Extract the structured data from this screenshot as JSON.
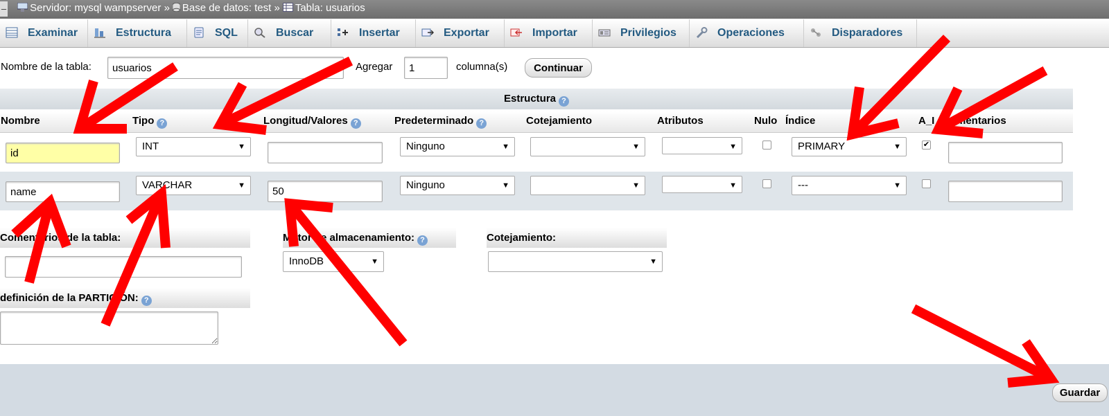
{
  "breadcrumb": {
    "server": "Servidor: mysql wampserver",
    "sep1": "»",
    "database": "Base de datos: test",
    "sep2": "»",
    "table": "Tabla: usuarios"
  },
  "tabs": [
    {
      "label": "Examinar",
      "icon": "browse-icon"
    },
    {
      "label": "Estructura",
      "icon": "structure-icon"
    },
    {
      "label": "SQL",
      "icon": "sql-icon"
    },
    {
      "label": "Buscar",
      "icon": "search-icon"
    },
    {
      "label": "Insertar",
      "icon": "insert-icon"
    },
    {
      "label": "Exportar",
      "icon": "export-icon"
    },
    {
      "label": "Importar",
      "icon": "import-icon"
    },
    {
      "label": "Privilegios",
      "icon": "privileges-icon"
    },
    {
      "label": "Operaciones",
      "icon": "wrench-icon"
    },
    {
      "label": "Disparadores",
      "icon": "triggers-icon"
    }
  ],
  "table_name": {
    "label": "Nombre de la tabla:",
    "value": "usuarios",
    "add_label": "Agregar",
    "add_value": "1",
    "columns_label": "columna(s)",
    "continue_label": "Continuar"
  },
  "structure": {
    "title": "Estructura",
    "headers": {
      "name": "Nombre",
      "type": "Tipo",
      "length": "Longitud/Valores",
      "default": "Predeterminado",
      "collation": "Cotejamiento",
      "attributes": "Atributos",
      "null": "Nulo",
      "index": "Índice",
      "ai": "A_I",
      "comments": "Comentarios"
    },
    "rows": [
      {
        "name": "id",
        "type": "INT",
        "length": "",
        "default": "Ninguno",
        "collation": "",
        "attributes": "",
        "null": false,
        "index": "PRIMARY",
        "ai": true,
        "comments": ""
      },
      {
        "name": "name",
        "type": "VARCHAR",
        "length": "50",
        "default": "Ninguno",
        "collation": "",
        "attributes": "",
        "null": false,
        "index": "---",
        "ai": false,
        "comments": ""
      }
    ]
  },
  "options": {
    "table_comments_label": "Comentarios de la tabla:",
    "engine_label": "Motor de almacenamiento:",
    "engine_value": "InnoDB",
    "collation_label": "Cotejamiento:",
    "collation_value": "",
    "partition_label": "definición de la PARTICIÓN:"
  },
  "footer": {
    "save_label": "Guardar"
  },
  "colors": {
    "arrow": "#ff0000",
    "link": "#235a81",
    "highlight_input": "#ffffa6"
  }
}
